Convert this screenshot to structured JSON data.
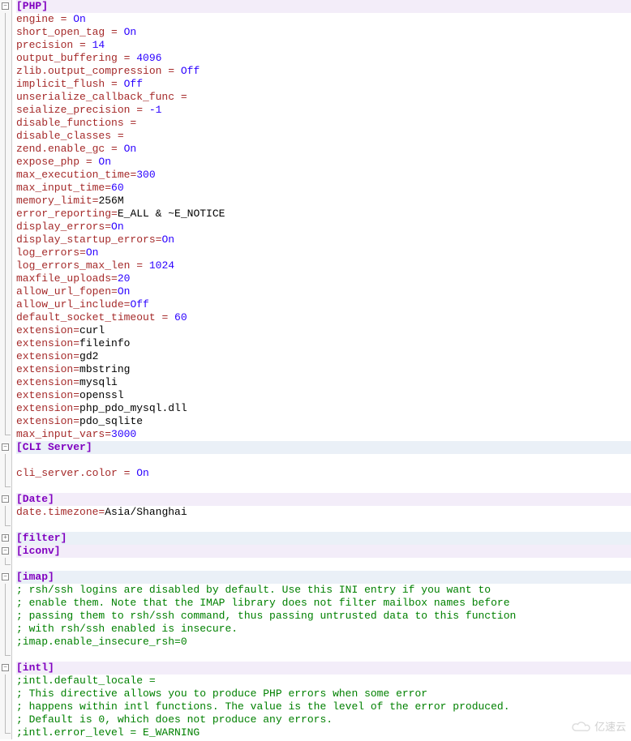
{
  "sections": [
    {
      "name": "PHP",
      "header": "[PHP]",
      "open": true,
      "lines": [
        {
          "type": "kv",
          "key": "engine",
          "sep": " = ",
          "val": "On",
          "valClass": "kw"
        },
        {
          "type": "kv",
          "key": "short_open_tag",
          "sep": " = ",
          "val": "On",
          "valClass": "kw"
        },
        {
          "type": "kv",
          "key": "precision",
          "sep": " = ",
          "val": "14",
          "valClass": "num"
        },
        {
          "type": "kv",
          "key": "output_buffering",
          "sep": " = ",
          "val": "4096",
          "valClass": "num"
        },
        {
          "type": "kv",
          "key": "zlib.output_compression",
          "sep": " = ",
          "val": "Off",
          "valClass": "kw"
        },
        {
          "type": "kv",
          "key": "implicit_flush",
          "sep": " = ",
          "val": "Off",
          "valClass": "kw"
        },
        {
          "type": "kv",
          "key": "unserialize_callback_func",
          "sep": " =",
          "val": "",
          "valClass": "txt"
        },
        {
          "type": "kv",
          "key": "seialize_precision",
          "sep": " = ",
          "val": "-1",
          "valClass": "num"
        },
        {
          "type": "kv",
          "key": "disable_functions",
          "sep": " =",
          "val": "",
          "valClass": "txt"
        },
        {
          "type": "kv",
          "key": "disable_classes",
          "sep": " =",
          "val": "",
          "valClass": "txt"
        },
        {
          "type": "kv",
          "key": "zend.enable_gc",
          "sep": " = ",
          "val": "On",
          "valClass": "kw"
        },
        {
          "type": "kv",
          "key": "expose_php",
          "sep": " = ",
          "val": "On",
          "valClass": "kw"
        },
        {
          "type": "kv",
          "key": "max_execution_time",
          "sep": "=",
          "val": "300",
          "valClass": "num"
        },
        {
          "type": "kv",
          "key": "max_input_time",
          "sep": "=",
          "val": "60",
          "valClass": "num"
        },
        {
          "type": "kv",
          "key": "memory_limit",
          "sep": "=",
          "val": "256M",
          "valClass": "txt"
        },
        {
          "type": "kv",
          "key": "error_reporting",
          "sep": "=",
          "val": "E_ALL & ~E_NOTICE",
          "valClass": "txt"
        },
        {
          "type": "kv",
          "key": "display_errors",
          "sep": "=",
          "val": "On",
          "valClass": "kw"
        },
        {
          "type": "kv",
          "key": "display_startup_errors",
          "sep": "=",
          "val": "On",
          "valClass": "kw"
        },
        {
          "type": "kv",
          "key": "log_errors",
          "sep": "=",
          "val": "On",
          "valClass": "kw"
        },
        {
          "type": "kv",
          "key": "log_errors_max_len",
          "sep": " = ",
          "val": "1024",
          "valClass": "num"
        },
        {
          "type": "kv",
          "key": "maxfile_uploads",
          "sep": "=",
          "val": "20",
          "valClass": "num"
        },
        {
          "type": "kv",
          "key": "allow_url_fopen",
          "sep": "=",
          "val": "On",
          "valClass": "kw"
        },
        {
          "type": "kv",
          "key": "allow_url_include",
          "sep": "=",
          "val": "Off",
          "valClass": "kw"
        },
        {
          "type": "kv",
          "key": "default_socket_timeout",
          "sep": " = ",
          "val": "60",
          "valClass": "num"
        },
        {
          "type": "kv",
          "key": "extension",
          "sep": "=",
          "val": "curl",
          "valClass": "txt"
        },
        {
          "type": "kv",
          "key": "extension",
          "sep": "=",
          "val": "fileinfo",
          "valClass": "txt"
        },
        {
          "type": "kv",
          "key": "extension",
          "sep": "=",
          "val": "gd2",
          "valClass": "txt"
        },
        {
          "type": "kv",
          "key": "extension",
          "sep": "=",
          "val": "mbstring",
          "valClass": "txt"
        },
        {
          "type": "kv",
          "key": "extension",
          "sep": "=",
          "val": "mysqli",
          "valClass": "txt"
        },
        {
          "type": "kv",
          "key": "extension",
          "sep": "=",
          "val": "openssl",
          "valClass": "txt"
        },
        {
          "type": "kv",
          "key": "extension",
          "sep": "=",
          "val": "php_pdo_mysql.dll",
          "valClass": "txt"
        },
        {
          "type": "kv",
          "key": "extension",
          "sep": "=",
          "val": "pdo_sqlite",
          "valClass": "txt"
        },
        {
          "type": "kv",
          "key": "max_input_vars",
          "sep": "=",
          "val": "3000",
          "valClass": "num"
        }
      ]
    },
    {
      "name": "CLI Server",
      "header": "[CLI Server]",
      "open": true,
      "lines": [
        {
          "type": "blank"
        },
        {
          "type": "kv",
          "key": "cli_server.color",
          "sep": " = ",
          "val": "On",
          "valClass": "kw"
        },
        {
          "type": "blank"
        }
      ]
    },
    {
      "name": "Date",
      "header": "[Date]",
      "open": true,
      "lines": [
        {
          "type": "kv",
          "key": "date.timezone",
          "sep": "=",
          "val": "Asia/Shanghai",
          "valClass": "txt"
        },
        {
          "type": "blank"
        }
      ]
    },
    {
      "name": "filter",
      "header": "[filter]",
      "open": false,
      "lines": []
    },
    {
      "name": "iconv",
      "header": "[iconv]",
      "open": true,
      "lines": [
        {
          "type": "blank"
        }
      ]
    },
    {
      "name": "imap",
      "header": "[imap]",
      "open": true,
      "lines": [
        {
          "type": "cmt",
          "text": "; rsh/ssh logins are disabled by default. Use this INI entry if you want to"
        },
        {
          "type": "cmt",
          "text": "; enable them. Note that the IMAP library does not filter mailbox names before"
        },
        {
          "type": "cmt",
          "text": "; passing them to rsh/ssh command, thus passing untrusted data to this function"
        },
        {
          "type": "cmt",
          "text": "; with rsh/ssh enabled is insecure."
        },
        {
          "type": "cmt",
          "text": ";imap.enable_insecure_rsh=0"
        },
        {
          "type": "blank"
        }
      ]
    },
    {
      "name": "intl",
      "header": "[intl]",
      "open": true,
      "lines": [
        {
          "type": "cmt",
          "text": ";intl.default_locale ="
        },
        {
          "type": "cmt",
          "text": "; This directive allows you to produce PHP errors when some error"
        },
        {
          "type": "cmt",
          "text": "; happens within intl functions. The value is the level of the error produced."
        },
        {
          "type": "cmt",
          "text": "; Default is 0, which does not produce any errors."
        },
        {
          "type": "cmt",
          "text": ";intl.error_level = E_WARNING"
        }
      ]
    }
  ],
  "watermark": "亿速云"
}
